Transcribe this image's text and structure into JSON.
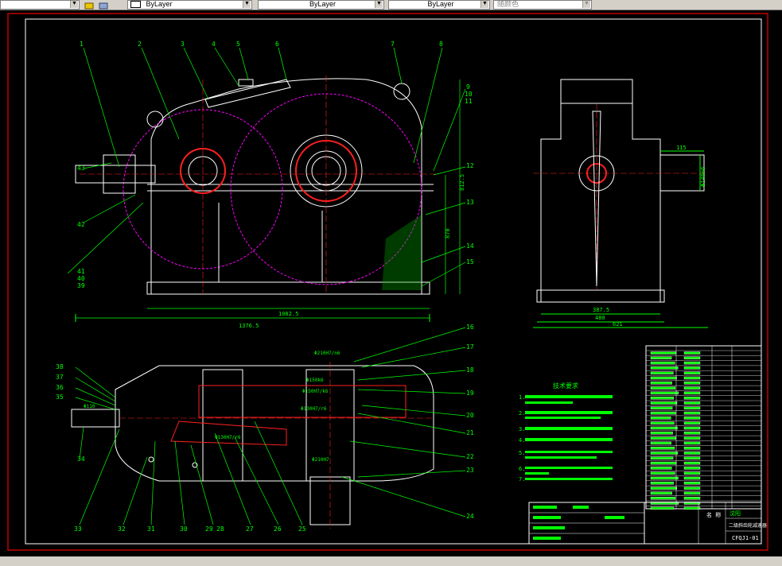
{
  "toolbar": {
    "layer_combo_1": "ByLayer",
    "layer_combo_2": "ByLayer",
    "layer_combo_3": "ByLayer",
    "color_combo": "随颜色"
  },
  "drawing": {
    "part_labels_top": [
      "1",
      "2",
      "3",
      "4",
      "5",
      "6",
      "7",
      "8",
      "9",
      "10",
      "11",
      "12",
      "13",
      "14",
      "15",
      "43",
      "42",
      "41",
      "40",
      "39"
    ],
    "part_labels_bottom": [
      "16",
      "17",
      "18",
      "19",
      "20",
      "21",
      "22",
      "23",
      "24",
      "38",
      "37",
      "36",
      "35",
      "34",
      "33",
      "32",
      "31",
      "30",
      "29",
      "28",
      "27",
      "26",
      "25"
    ],
    "dimensions": {
      "front_width": "1376.5",
      "front_inner": "1082.5",
      "height_1": "870",
      "height_2": "812.5",
      "side_width": "480",
      "side_inner": "387.5",
      "side_total": "621",
      "side_shaft": "115",
      "side_shaft_dia": "Φ140m6",
      "plan_d1": "Φ210H7/n6",
      "plan_d2": "Φ150k6",
      "plan_d3": "Φ150H7/k6",
      "plan_d4": "Φ130H7/r6",
      "plan_d5": "Φ210H7",
      "plan_d6": "Φ110",
      "plan_d7": "Φ130H7/r6"
    },
    "tech_title": "技术要求",
    "tech_notes": [
      "1.",
      "2.",
      "3.",
      "4.",
      "5.",
      "6.",
      "7."
    ],
    "title_block": {
      "school": "沈阳",
      "name": "二级斜齿轮减速器",
      "code": "CFQJ1-01",
      "table_header": "名 称"
    }
  },
  "colors": {
    "canvas": "#000000",
    "frame": "#c00000",
    "green": "#00ff00",
    "magenta": "#ff00ff",
    "red": "#ff2020",
    "white": "#ffffff",
    "cyan": "#00ffff"
  }
}
